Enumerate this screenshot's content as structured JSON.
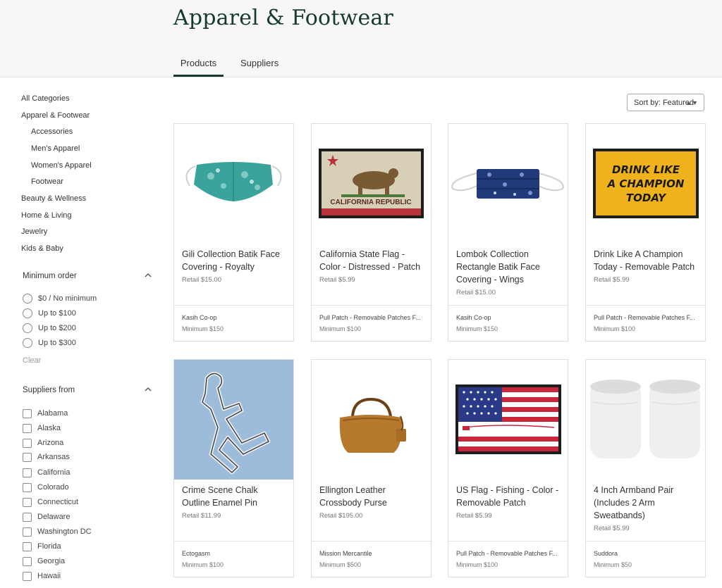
{
  "header": {
    "title": "Apparel & Footwear",
    "tabs": [
      {
        "label": "Products",
        "active": true
      },
      {
        "label": "Suppliers",
        "active": false
      }
    ]
  },
  "sidebar": {
    "categories": [
      {
        "label": "All Categories"
      },
      {
        "label": "Apparel & Footwear"
      },
      {
        "label": "Accessories"
      },
      {
        "label": "Men's Apparel"
      },
      {
        "label": "Women's Apparel"
      },
      {
        "label": "Footwear"
      },
      {
        "label": "Beauty & Wellness"
      },
      {
        "label": "Home & Living"
      },
      {
        "label": "Jewelry"
      },
      {
        "label": "Kids & Baby"
      }
    ],
    "minimum_order": {
      "title": "Minimum order",
      "options": [
        "$0 / No minimum",
        "Up to $100",
        "Up to $200",
        "Up to $300"
      ],
      "clear_label": "Clear"
    },
    "suppliers_from": {
      "title": "Suppliers from",
      "options": [
        "Alabama",
        "Alaska",
        "Arizona",
        "Arkansas",
        "California",
        "Colorado",
        "Connecticut",
        "Delaware",
        "Washington DC",
        "Florida",
        "Georgia",
        "Hawaii"
      ]
    }
  },
  "sort": {
    "label": "Sort by: Featured"
  },
  "products": [
    {
      "name": "Gili Collection Batik Face Covering - Royalty",
      "retail": "Retail $15.00",
      "supplier": "Kasih Co-op",
      "minimum": "Minimum $150"
    },
    {
      "name": "California State Flag - Color - Distressed - Patch",
      "retail": "Retail $5.99",
      "supplier": "Pull Patch - Removable Patches F...",
      "minimum": "Minimum $100",
      "image_text": "CALIFORNIA REPUBLIC"
    },
    {
      "name": "Lombok Collection Rectangle Batik Face Covering - Wings",
      "retail": "Retail $15.00",
      "supplier": "Kasih Co-op",
      "minimum": "Minimum $150"
    },
    {
      "name": "Drink Like A Champion Today - Removable Patch",
      "retail": "Retail $5.99",
      "supplier": "Pull Patch - Removable Patches F...",
      "minimum": "Minimum $100",
      "image_text": [
        "DRINK LIKE",
        "A CHAMPION",
        "TODAY"
      ]
    },
    {
      "name": "Crime Scene Chalk Outline Enamel Pin",
      "retail": "Retail $11.99",
      "supplier": "Ectogasm",
      "minimum": "Minimum $100"
    },
    {
      "name": "Ellington Leather Crossbody Purse",
      "retail": "Retail $195.00",
      "supplier": "Mission Mercantile",
      "minimum": "Minimum $500"
    },
    {
      "name": "US Flag - Fishing - Color - Removable Patch",
      "retail": "Retail $5.99",
      "supplier": "Pull Patch - Removable Patches F...",
      "minimum": "Minimum $100"
    },
    {
      "name": "4 Inch Armband Pair (Includes 2 Arm Sweatbands)",
      "retail": "Retail $5.99",
      "supplier": "Suddora",
      "minimum": "Minimum $50"
    }
  ],
  "colors": {
    "brand": "#163a2c",
    "patch_yellow": "#f0b21a",
    "flag_red": "#c8263a",
    "flag_blue": "#2b3a86"
  }
}
